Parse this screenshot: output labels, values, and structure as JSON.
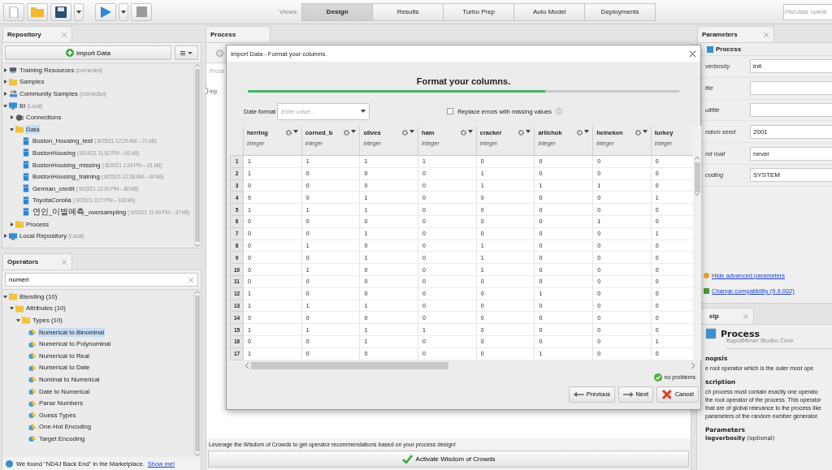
{
  "toolbar": {
    "views_label": "Views:",
    "views": [
      {
        "label": "Design",
        "selected": true
      },
      {
        "label": "Results",
        "selected": false
      },
      {
        "label": "Turbo Prep",
        "selected": false
      },
      {
        "label": "Auto Model",
        "selected": false
      },
      {
        "label": "Deployments",
        "selected": false
      }
    ],
    "search": {
      "placeholder": "Find data, operat"
    }
  },
  "repository": {
    "title": "Repository",
    "import_button": "Import Data",
    "tree": [
      {
        "name": "Training Resources",
        "meta": "(connected)",
        "kind": "server",
        "expanded": false,
        "selected": false
      },
      {
        "name": "Samples",
        "kind": "folder",
        "expanded": false,
        "selected": false
      },
      {
        "name": "Community Samples",
        "meta": "(connected)",
        "kind": "people",
        "expanded": false,
        "selected": false
      },
      {
        "name": "BI",
        "meta": "(Local)",
        "kind": "computer",
        "expanded": true,
        "selected": false,
        "children": [
          {
            "name": "Connections",
            "kind": "plug",
            "expanded": false,
            "selected": false
          },
          {
            "name": "Data",
            "kind": "folder",
            "expanded": true,
            "selected": true,
            "children": [
              {
                "name": "Boston_Housing_test",
                "meta": "( 8/25/21 12:29 AM – 21 kB)",
                "kind": "data",
                "selected": false
              },
              {
                "name": "BostonHousing",
                "meta": "( 8/24/21 11:52 PM – 61 kB)",
                "kind": "data",
                "selected": false
              },
              {
                "name": "BostonHousing_missing",
                "meta": "( 8/20/21 1:24 PM – 61 kB)",
                "kind": "data",
                "selected": false
              },
              {
                "name": "BostonHousing_training",
                "meta": "( 8/25/21 12:28 AM – 44 kB)",
                "kind": "data",
                "selected": false
              },
              {
                "name": "German_credit",
                "meta": "( 9/13/21 12:30 PM – 80 kB)",
                "kind": "data",
                "selected": false
              },
              {
                "name": "ToyotaCorolla",
                "meta": "( 8/20/21 3:27 PM – 118 kB)",
                "kind": "data",
                "selected": false
              },
              {
                "name": "연인_이별예측_oversampling",
                "meta": "( 9/10/21 11:49 PM – 37 kB)",
                "kind": "data",
                "selected": false
              }
            ]
          },
          {
            "name": "Process",
            "kind": "folder",
            "expanded": false,
            "selected": false
          }
        ]
      },
      {
        "name": "Local Repository",
        "meta": "(Local)",
        "kind": "computer",
        "expanded": false,
        "selected": false
      }
    ]
  },
  "operators": {
    "title": "Operators",
    "search": {
      "value": "numeri"
    },
    "tree": [
      {
        "name": "Blending (10)",
        "kind": "folder",
        "expanded": true,
        "selected": false,
        "children": [
          {
            "name": "Attributes (10)",
            "kind": "folder",
            "expanded": true,
            "selected": false,
            "children": [
              {
                "name": "Types (10)",
                "kind": "folder",
                "expanded": true,
                "selected": false,
                "children": [
                  {
                    "name": "Numerical to Binominal",
                    "kind": "operator",
                    "selected": true
                  },
                  {
                    "name": "Numerical to Polynominal",
                    "kind": "operator",
                    "selected": false
                  },
                  {
                    "name": "Numerical to Real",
                    "kind": "operator",
                    "selected": false
                  },
                  {
                    "name": "Numerical to Date",
                    "kind": "operator",
                    "selected": false
                  },
                  {
                    "name": "Nominal to Numerical",
                    "kind": "operator",
                    "selected": false
                  },
                  {
                    "name": "Date to Numerical",
                    "kind": "operator",
                    "selected": false
                  },
                  {
                    "name": "Parse Numbers",
                    "kind": "operator",
                    "selected": false
                  },
                  {
                    "name": "Guess Types",
                    "kind": "operator",
                    "selected": false
                  },
                  {
                    "name": "One-Hot Encoding",
                    "kind": "operator",
                    "selected": false
                  },
                  {
                    "name": "Target Encoding",
                    "kind": "operator",
                    "selected": false
                  }
                ]
              }
            ]
          }
        ]
      }
    ],
    "notice": {
      "text": "We found \"ND4J Back End\" in the Marketplace.",
      "link": "Show me!"
    }
  },
  "process": {
    "title": "Process",
    "canvas_label": "Proce",
    "port": "inp",
    "hint": "Leverage the Wisdom of Crowds to get operator recommendations based on your process design!",
    "wisdom_button": "Activate Wisdom of Crowds"
  },
  "dialog": {
    "title": "Import Data - Format your columns.",
    "heading": "Format your columns.",
    "progress": {
      "level": 0.69
    },
    "date_format": {
      "label": "Date format",
      "placeholder": "Enter value..."
    },
    "replace_errors": {
      "label": "Replace errors with missing values",
      "checked": false
    },
    "columns": [
      {
        "name": "herring",
        "type": "integer"
      },
      {
        "name": "corned_b",
        "type": "integer"
      },
      {
        "name": "olives",
        "type": "integer"
      },
      {
        "name": "ham",
        "type": "integer"
      },
      {
        "name": "cracker",
        "type": "integer"
      },
      {
        "name": "artichok",
        "type": "integer"
      },
      {
        "name": "heineken",
        "type": "integer"
      },
      {
        "name": "turkey",
        "type": "integer"
      }
    ],
    "rows": [
      {
        "index": "1",
        "cells": [
          "1",
          "1",
          "1",
          "1",
          "0",
          "0",
          "0",
          "0"
        ]
      },
      {
        "index": "2",
        "cells": [
          "1",
          "0",
          "0",
          "0",
          "1",
          "0",
          "0",
          "0"
        ]
      },
      {
        "index": "3",
        "cells": [
          "0",
          "0",
          "0",
          "0",
          "1",
          "1",
          "1",
          "0"
        ]
      },
      {
        "index": "4",
        "cells": [
          "0",
          "0",
          "1",
          "0",
          "0",
          "0",
          "0",
          "1"
        ]
      },
      {
        "index": "5",
        "cells": [
          "1",
          "1",
          "1",
          "0",
          "0",
          "0",
          "0",
          "0"
        ]
      },
      {
        "index": "6",
        "cells": [
          "0",
          "0",
          "0",
          "0",
          "0",
          "0",
          "1",
          "0"
        ]
      },
      {
        "index": "7",
        "cells": [
          "0",
          "0",
          "1",
          "0",
          "0",
          "0",
          "0",
          "1"
        ]
      },
      {
        "index": "8",
        "cells": [
          "0",
          "1",
          "0",
          "0",
          "1",
          "0",
          "0",
          "0"
        ]
      },
      {
        "index": "9",
        "cells": [
          "0",
          "0",
          "1",
          "0",
          "1",
          "0",
          "0",
          "0"
        ]
      },
      {
        "index": "10",
        "cells": [
          "0",
          "1",
          "0",
          "0",
          "1",
          "0",
          "0",
          "0"
        ]
      },
      {
        "index": "11",
        "cells": [
          "0",
          "0",
          "0",
          "0",
          "0",
          "0",
          "0",
          "0"
        ]
      },
      {
        "index": "12",
        "cells": [
          "1",
          "0",
          "0",
          "0",
          "0",
          "1",
          "0",
          "0"
        ]
      },
      {
        "index": "13",
        "cells": [
          "1",
          "1",
          "1",
          "0",
          "0",
          "0",
          "0",
          "0"
        ]
      },
      {
        "index": "14",
        "cells": [
          "0",
          "0",
          "0",
          "0",
          "0",
          "0",
          "0",
          "0"
        ]
      },
      {
        "index": "15",
        "cells": [
          "1",
          "1",
          "1",
          "1",
          "0",
          "0",
          "0",
          "0"
        ]
      },
      {
        "index": "16",
        "cells": [
          "0",
          "0",
          "1",
          "0",
          "0",
          "0",
          "0",
          "1"
        ]
      },
      {
        "index": "17",
        "cells": [
          "1",
          "0",
          "0",
          "0",
          "0",
          "1",
          "0",
          "0"
        ]
      }
    ],
    "status": "no problems.",
    "buttons": [
      {
        "label": "Previous",
        "kind": "back"
      },
      {
        "label": "Next",
        "kind": "next"
      },
      {
        "label": "Cancel",
        "kind": "cancel"
      }
    ]
  },
  "parameters": {
    "title": "Parameters",
    "operator": "Process",
    "rows": [
      {
        "label": "verbosity",
        "value": "init"
      },
      {
        "label": "file"
      },
      {
        "label": "ultfile"
      },
      {
        "label": "ndom seed",
        "value": "2001"
      },
      {
        "label": "nd mail",
        "value": "never"
      },
      {
        "label": "coding",
        "value": "SYSTEM"
      }
    ],
    "links": [
      "Hide advanced parameters",
      "Change compatibility (9.9.002)"
    ]
  },
  "help": {
    "title": "elp",
    "operator": "Process",
    "subtitle": "RapidMiner Studio Core",
    "sections": [
      {
        "heading": "nopsis",
        "text": [
          "e root operator which is the outer most ope"
        ]
      },
      {
        "heading": "scription",
        "text": [
          "ch process must contain exactly one operato",
          "the root operator of the process. This operator",
          "that are of global relevance to the process like",
          "parameters of the random number generator."
        ]
      },
      {
        "heading": "Parameters"
      }
    ],
    "param": {
      "name": "logverbosity",
      "note": "(optional)"
    }
  }
}
